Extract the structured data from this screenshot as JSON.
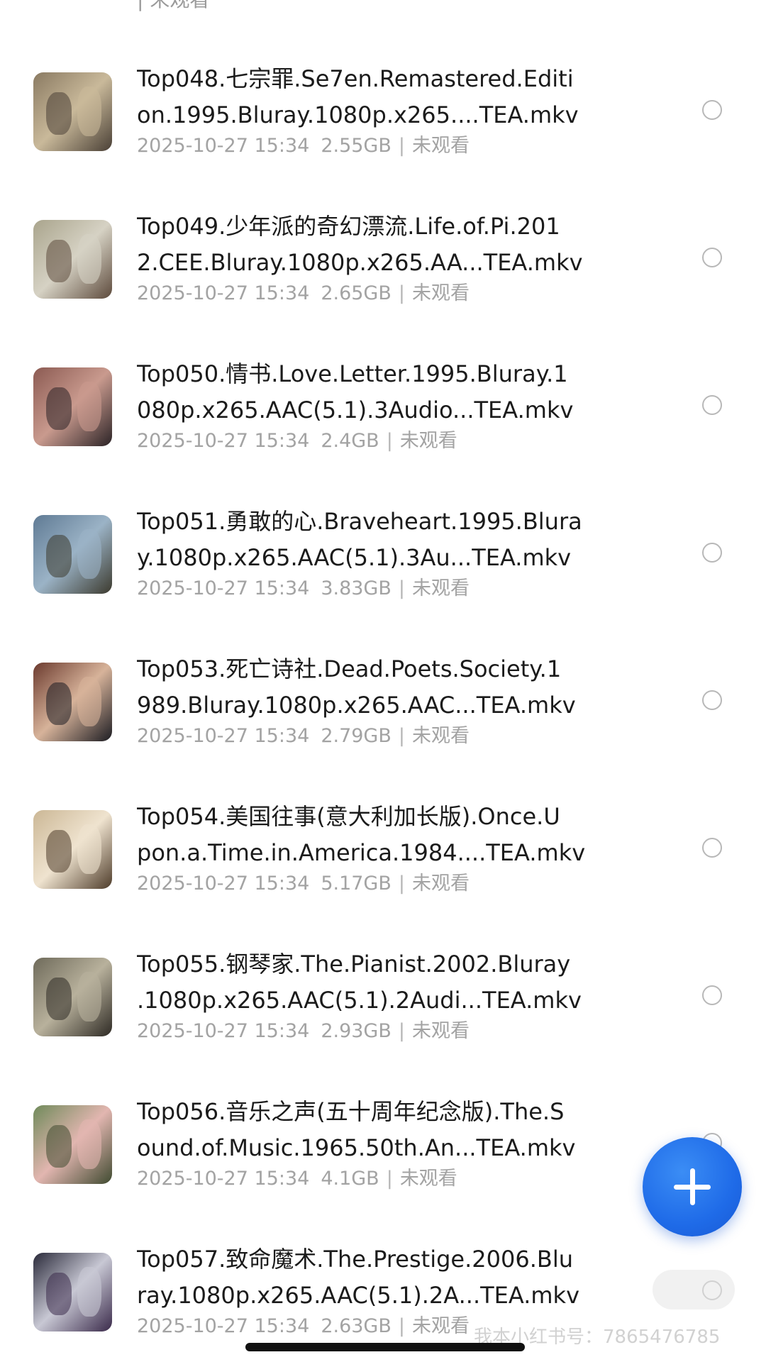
{
  "top_partial_text": "| 未观看",
  "items": [
    {
      "title_line1": "Top048.七宗罪.Se7en.Remastered.Editi",
      "title_line2": "on.1995.Bluray.1080p.x265....TEA.mkv",
      "date": "2025-10-27 15:34",
      "size": "2.55GB",
      "status": "未观看",
      "thumb_colors": [
        "#8a7a62",
        "#c9b99a",
        "#4a4036"
      ]
    },
    {
      "title_line1": "Top049.少年派的奇幻漂流.Life.of.Pi.201",
      "title_line2": "2.CEE.Bluray.1080p.x265.AA...TEA.mkv",
      "date": "2025-10-27 15:34",
      "size": "2.65GB",
      "status": "未观看",
      "thumb_colors": [
        "#a9a48c",
        "#d6d2c4",
        "#5d4a3c"
      ]
    },
    {
      "title_line1": "Top050.情书.Love.Letter.1995.Bluray.1",
      "title_line2": "080p.x265.AAC(5.1).3Audio...TEA.mkv",
      "date": "2025-10-27 15:34",
      "size": "2.4GB",
      "status": "未观看",
      "thumb_colors": [
        "#8b5a52",
        "#c99a8e",
        "#2b2326"
      ]
    },
    {
      "title_line1": "Top051.勇敢的心.Braveheart.1995.Blura",
      "title_line2": "y.1080p.x265.AAC(5.1).3Au...TEA.mkv",
      "date": "2025-10-27 15:34",
      "size": "3.83GB",
      "status": "未观看",
      "thumb_colors": [
        "#5f7a94",
        "#9bb3c6",
        "#3c3a2e"
      ]
    },
    {
      "title_line1": "Top053.死亡诗社.Dead.Poets.Society.1",
      "title_line2": "989.Bluray.1080p.x265.AAC...TEA.mkv",
      "date": "2025-10-27 15:34",
      "size": "2.79GB",
      "status": "未观看",
      "thumb_colors": [
        "#6b3a2e",
        "#d7b39a",
        "#1c1c22"
      ]
    },
    {
      "title_line1": "Top054.美国往事(意大利加长版).Once.U",
      "title_line2": "pon.a.Time.in.America.1984....TEA.mkv",
      "date": "2025-10-27 15:34",
      "size": "5.17GB",
      "status": "未观看",
      "thumb_colors": [
        "#cbb795",
        "#efe3cf",
        "#4e3c2a"
      ]
    },
    {
      "title_line1": "Top055.钢琴家.The.Pianist.2002.Bluray",
      "title_line2": ".1080p.x265.AAC(5.1).2Audi...TEA.mkv",
      "date": "2025-10-27 15:34",
      "size": "2.93GB",
      "status": "未观看",
      "thumb_colors": [
        "#6e6a5a",
        "#b8b19c",
        "#2e2a24"
      ]
    },
    {
      "title_line1": "Top056.音乐之声(五十周年纪念版).The.S",
      "title_line2": "ound.of.Music.1965.50th.An...TEA.mkv",
      "date": "2025-10-27 15:34",
      "size": "4.1GB",
      "status": "未观看",
      "thumb_colors": [
        "#6f8a5a",
        "#e2b6b0",
        "#3f4a30"
      ]
    },
    {
      "title_line1": "Top057.致命魔术.The.Prestige.2006.Blu",
      "title_line2": "ray.1080p.x265.AAC(5.1).2A...TEA.mkv",
      "date": "2025-10-27 15:34",
      "size": "2.63GB",
      "status": "未观看",
      "thumb_colors": [
        "#2a2a3a",
        "#c8c8d4",
        "#3a2a4a"
      ]
    }
  ],
  "fab": {
    "icon": "plus-icon",
    "color": "#1f6be8"
  },
  "badge_icon": "xiaohongshu-badge",
  "watermark": "我本小红书号：7865476785"
}
